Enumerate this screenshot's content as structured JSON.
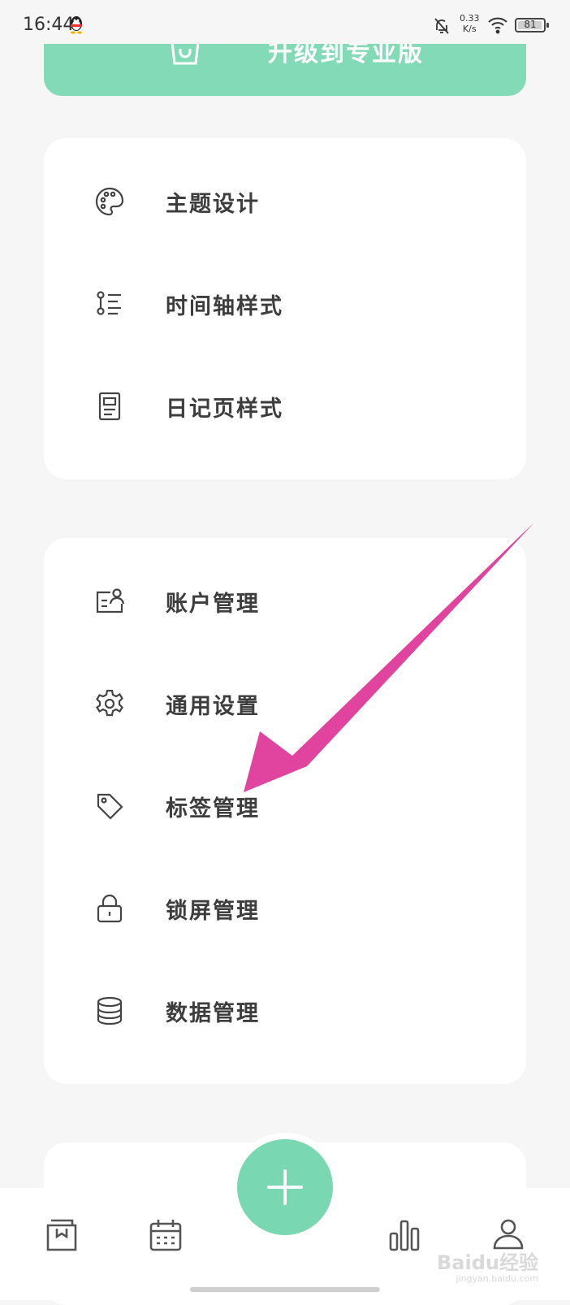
{
  "status_bar": {
    "time": "16:44",
    "net_speed": "0.33",
    "net_unit": "K/s",
    "battery": "81"
  },
  "upgrade_banner": {
    "label": "升级到专业版"
  },
  "card_display": {
    "items": [
      {
        "label": "主题设计",
        "icon": "palette-icon"
      },
      {
        "label": "时间轴样式",
        "icon": "timeline-icon"
      },
      {
        "label": "日记页样式",
        "icon": "page-icon"
      }
    ]
  },
  "card_settings": {
    "items": [
      {
        "label": "账户管理",
        "icon": "account-card-icon"
      },
      {
        "label": "通用设置",
        "icon": "gear-icon"
      },
      {
        "label": "标签管理",
        "icon": "tag-icon"
      },
      {
        "label": "锁屏管理",
        "icon": "lock-icon"
      },
      {
        "label": "数据管理",
        "icon": "database-icon"
      }
    ]
  },
  "bottom_nav": {
    "items": [
      "diary-book-icon",
      "calendar-icon",
      "add-icon",
      "stats-icon",
      "profile-icon"
    ]
  },
  "watermark": {
    "brand": "Baidu经验",
    "url": "jingyan.baidu.com"
  },
  "colors": {
    "accent": "#79d7b1",
    "annotation_arrow": "#e0449f",
    "background": "#f6f6f6"
  }
}
